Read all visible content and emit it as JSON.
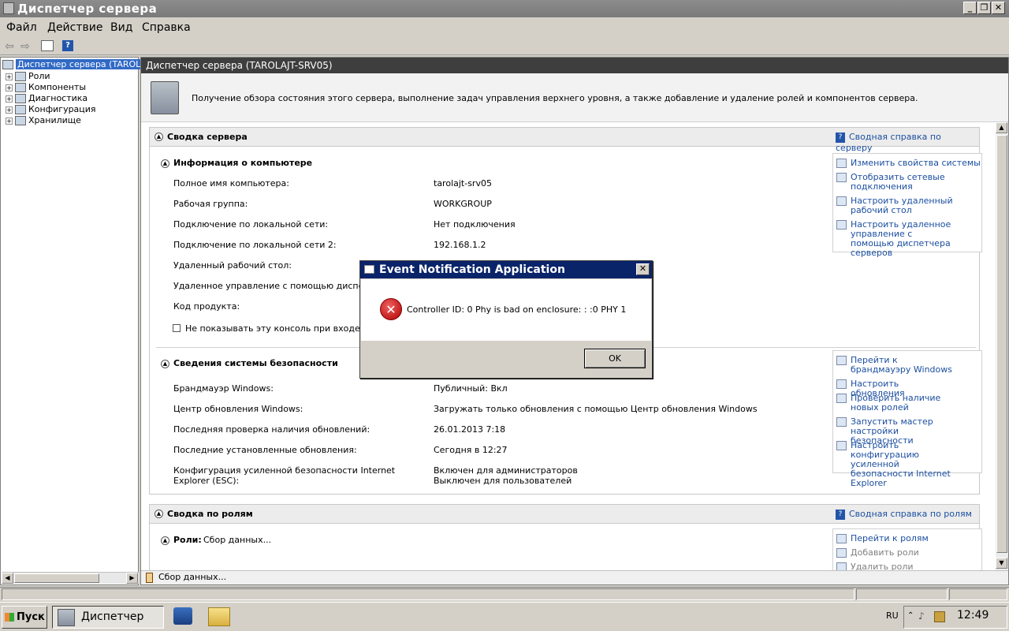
{
  "window": {
    "title": "Диспетчер сервера",
    "minimize": "_",
    "restore": "❐",
    "close": "✕"
  },
  "menu": [
    "Файл",
    "Действие",
    "Вид",
    "Справка"
  ],
  "toolbar": {
    "back": "⇦",
    "forward": "⇨",
    "help": "?"
  },
  "tree": {
    "root": "Диспетчер сервера (TAROLA",
    "items": [
      "Роли",
      "Компоненты",
      "Диагностика",
      "Конфигурация",
      "Хранилище"
    ]
  },
  "pane": {
    "header": "Диспетчер сервера (TAROLAJT-SRV05)",
    "description": "Получение обзора состояния этого сервера, выполнение задач управления верхнего уровня, а также добавление и удаление ролей и компонентов сервера."
  },
  "summary": {
    "title": "Сводка сервера",
    "help": "Сводная справка по серверу",
    "computer_info": {
      "title": "Информация о компьютере",
      "rows": [
        {
          "label": "Полное имя компьютера:",
          "value": "tarolajt-srv05"
        },
        {
          "label": "Рабочая группа:",
          "value": "WORKGROUP"
        },
        {
          "label": "Подключение по локальной сети:",
          "value": "Нет подключения"
        },
        {
          "label": "Подключение по локальной сети 2:",
          "value": "192.168.1.2"
        },
        {
          "label": "Удаленный рабочий стол:",
          "value": ""
        },
        {
          "label": "Удаленное управление с помощью диспетчера",
          "value": ""
        },
        {
          "label": "Код продукта:",
          "value": ""
        }
      ],
      "checkbox_label": "Не показывать эту консоль при входе в сист",
      "actions": [
        "Изменить свойства системы",
        "Отобразить сетевые подключения",
        "Настроить удаленный рабочий стол",
        "Настроить удаленное управление с помощью диспетчера серверов"
      ]
    },
    "security": {
      "title": "Сведения системы безопасности",
      "rows": [
        {
          "label": "Брандмауэр Windows:",
          "value": "Публичный: Вкл"
        },
        {
          "label": "Центр обновления Windows:",
          "value": "Загружать только обновления с помощью Центр обновления Windows"
        },
        {
          "label": "Последняя проверка наличия обновлений:",
          "value": "26.01.2013 7:18"
        },
        {
          "label": "Последние установленные обновления:",
          "value": "Сегодня в 12:27"
        },
        {
          "label": "Конфигурация усиленной безопасности Internet Explorer (ESC):",
          "value": "Включен для администраторов\nВыключен для пользователей"
        }
      ],
      "actions": [
        "Перейти к брандмауэру Windows",
        "Настроить обновления",
        "Проверить наличие новых ролей",
        "Запустить мастер настройки безопасности",
        "Настроить конфигурацию усиленной безопасности Internet Explorer"
      ]
    }
  },
  "roles": {
    "title": "Сводка по ролям",
    "help": "Сводная справка по ролям",
    "sub_title": "Роли:",
    "sub_value": "Сбор данных...",
    "actions": [
      "Перейти к ролям",
      "Добавить роли",
      "Удалить роли"
    ]
  },
  "pane_status": "Сбор данных...",
  "dialog": {
    "title": "Event Notification Application",
    "message": "Controller ID: 0  Phy is bad on enclosure:   :  :0 PHY 1",
    "ok": "OK",
    "close": "✕"
  },
  "taskbar": {
    "start": "Пуск",
    "task": "Диспетчер с...",
    "lang": "RU",
    "clock": "12:49"
  }
}
